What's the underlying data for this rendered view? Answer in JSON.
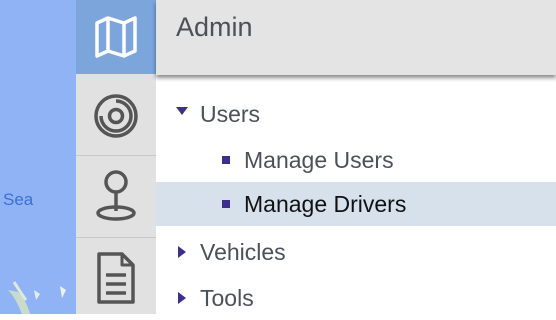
{
  "map": {
    "label": "Sea"
  },
  "rail": {
    "items": [
      {
        "icon": "map-icon",
        "active": true
      },
      {
        "icon": "target-icon",
        "active": false
      },
      {
        "icon": "location-pin-icon",
        "active": false
      },
      {
        "icon": "document-icon",
        "active": false
      }
    ]
  },
  "panel": {
    "title": "Admin",
    "tree": [
      {
        "label": "Users",
        "expanded": true,
        "children": [
          {
            "label": "Manage Users",
            "selected": false
          },
          {
            "label": "Manage Drivers",
            "selected": true
          }
        ]
      },
      {
        "label": "Vehicles",
        "expanded": false
      },
      {
        "label": "Tools",
        "expanded": false
      }
    ]
  },
  "colors": {
    "rail_active": "#7ba5db",
    "rail_bg": "#e1e1e1",
    "selected_row": "#d6e1ec",
    "bullet": "#3d2e8c",
    "map_water": "#8fb3f4"
  }
}
